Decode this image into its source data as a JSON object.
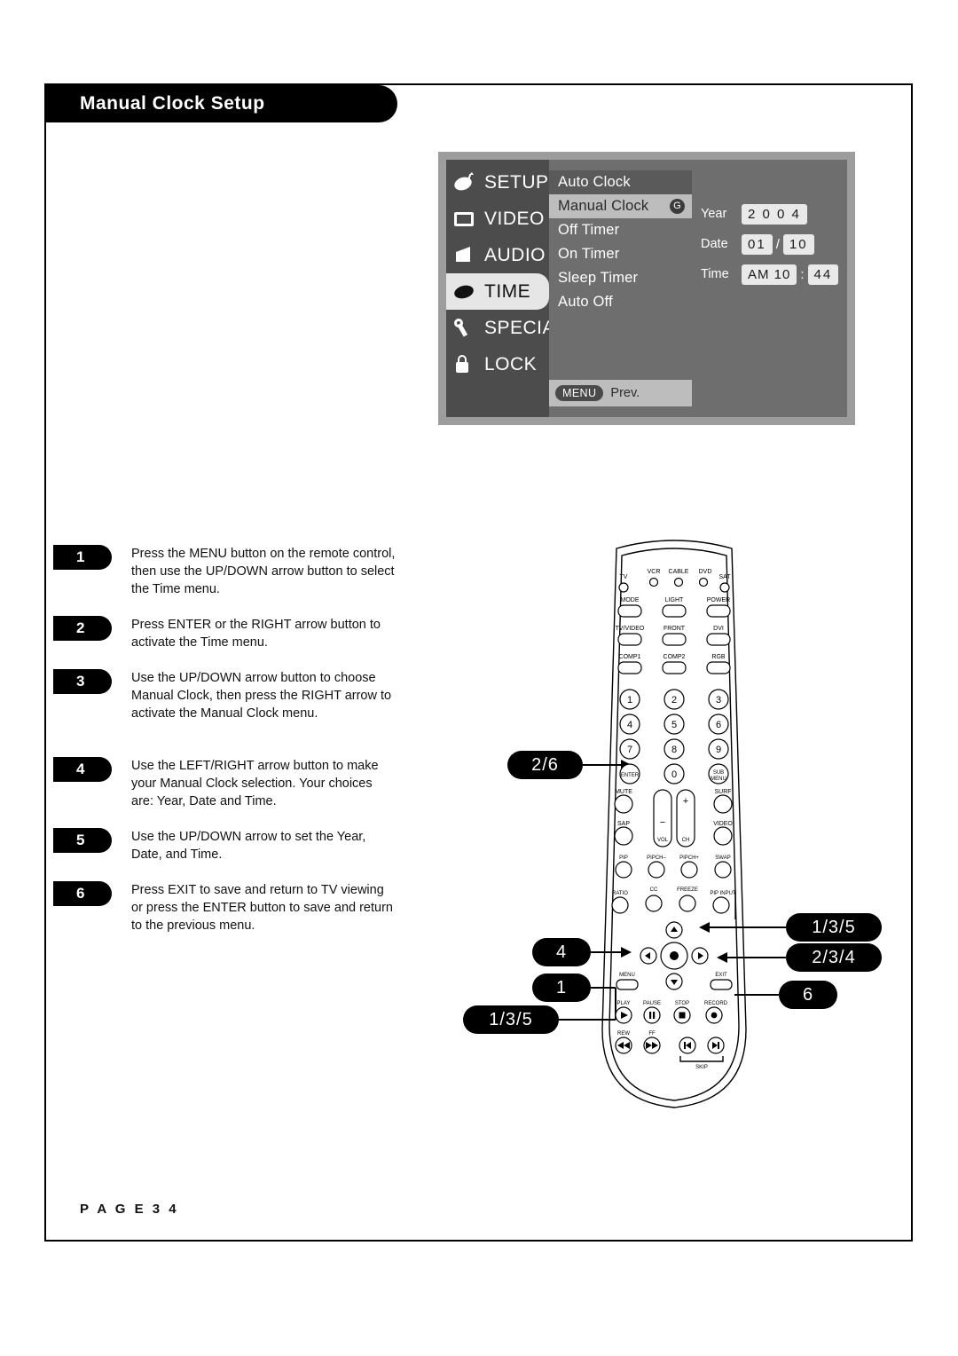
{
  "page": {
    "title": "Manual Clock Setup",
    "footer": "P A G E   3 4"
  },
  "osd": {
    "categories": [
      {
        "label": "SETUP",
        "icon": "satellite-dish-icon",
        "active": false
      },
      {
        "label": "VIDEO",
        "icon": "tv-screen-icon",
        "active": false
      },
      {
        "label": "AUDIO",
        "icon": "speaker-icon",
        "active": false
      },
      {
        "label": "TIME",
        "icon": "clock-icon",
        "active": true
      },
      {
        "label": "SPECIAL",
        "icon": "wrench-icon",
        "active": false
      },
      {
        "label": "LOCK",
        "icon": "padlock-icon",
        "active": false
      }
    ],
    "menu": [
      {
        "label": "Auto Clock",
        "state": "highlight"
      },
      {
        "label": "Manual Clock",
        "state": "selected"
      },
      {
        "label": "Off Timer",
        "state": "normal"
      },
      {
        "label": "On Timer",
        "state": "normal"
      },
      {
        "label": "Sleep Timer",
        "state": "normal"
      },
      {
        "label": "Auto Off",
        "state": "normal"
      }
    ],
    "selected_marker": "G",
    "prev_bar": {
      "button": "MENU",
      "label": "Prev."
    },
    "fields": [
      {
        "label": "Year",
        "values": [
          "2 0 0 4"
        ],
        "separators": []
      },
      {
        "label": "Date",
        "values": [
          "01",
          "10"
        ],
        "separators": [
          "/"
        ]
      },
      {
        "label": "Time",
        "values": [
          "AM 10",
          "44"
        ],
        "separators": [
          ":"
        ]
      }
    ]
  },
  "steps": [
    {
      "num": "1",
      "text": "Press the MENU button on the remote control, then use the UP/DOWN arrow button to select the Time menu."
    },
    {
      "num": "2",
      "text": "Press ENTER or the RIGHT arrow button to activate the Time menu."
    },
    {
      "num": "3",
      "text": "Use the UP/DOWN arrow button to choose Manual Clock, then press the RIGHT arrow to activate the Manual Clock menu."
    },
    {
      "num": "4",
      "text": "Use the LEFT/RIGHT arrow button to make your Manual Clock selection. Your choices are: Year, Date and Time."
    },
    {
      "num": "5",
      "text": "Use the UP/DOWN arrow to set the Year, Date, and Time."
    },
    {
      "num": "6",
      "text": "Press EXIT to save and return to TV viewing or press the ENTER button to save and return to the previous menu."
    }
  ],
  "callouts": [
    {
      "id": "callout-2-6",
      "label": "2/6"
    },
    {
      "id": "callout-1-3-5-right",
      "label": "1/3/5"
    },
    {
      "id": "callout-2-3-4",
      "label": "2/3/4"
    },
    {
      "id": "callout-4",
      "label": "4"
    },
    {
      "id": "callout-1",
      "label": "1"
    },
    {
      "id": "callout-6",
      "label": "6"
    },
    {
      "id": "callout-1-3-5-bottom",
      "label": "1/3/5"
    }
  ],
  "remote": {
    "device_labels": [
      "TV",
      "VCR",
      "CABLE",
      "DVD",
      "SAT"
    ],
    "row_mode": [
      "MODE",
      "LIGHT",
      "POWER"
    ],
    "row_tvvideo": [
      "TV/VIDEO",
      "FRONT",
      "DVI"
    ],
    "row_comp": [
      "COMP1",
      "COMP2",
      "RGB"
    ],
    "keypad": [
      "1",
      "2",
      "3",
      "4",
      "5",
      "6",
      "7",
      "8",
      "9",
      "ENTER",
      "0",
      "SUB.MENU"
    ],
    "row_mute": [
      "MUTE",
      "SURF"
    ],
    "row_sap": [
      "SAP",
      "VIDEO"
    ],
    "vol_label": "VOL",
    "ch_label": "CH",
    "plus": "+",
    "minus": "−",
    "row_pip": [
      "PIP",
      "PIPCH–",
      "PIPCH+",
      "SWAP"
    ],
    "row_ratio": [
      "RATIO",
      "CC",
      "FREEZE",
      "PIP INPUT"
    ],
    "nav": {
      "menu": "MENU",
      "exit": "EXIT"
    },
    "row_play": [
      "PLAY",
      "PAUSE",
      "STOP",
      "RECORD"
    ],
    "row_rew": [
      "REW",
      "FF",
      "SKIP"
    ]
  }
}
